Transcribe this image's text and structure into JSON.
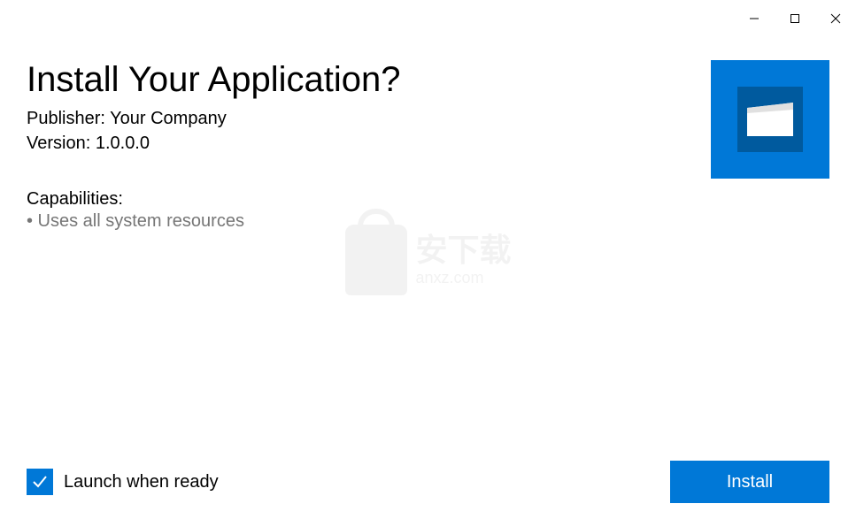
{
  "dialog": {
    "title": "Install Your Application?",
    "publisher_label": "Publisher: ",
    "publisher_value": "Your Company",
    "version_label": "Version: ",
    "version_value": "1.0.0.0",
    "capabilities_label": "Capabilities:",
    "capabilities": [
      "• Uses all system resources"
    ]
  },
  "footer": {
    "launch_checkbox_label": "Launch when ready",
    "launch_checked": true,
    "install_button_label": "Install"
  },
  "colors": {
    "accent": "#0078d7"
  },
  "watermark": {
    "text": "安下载",
    "subtext": "anxz.com"
  }
}
